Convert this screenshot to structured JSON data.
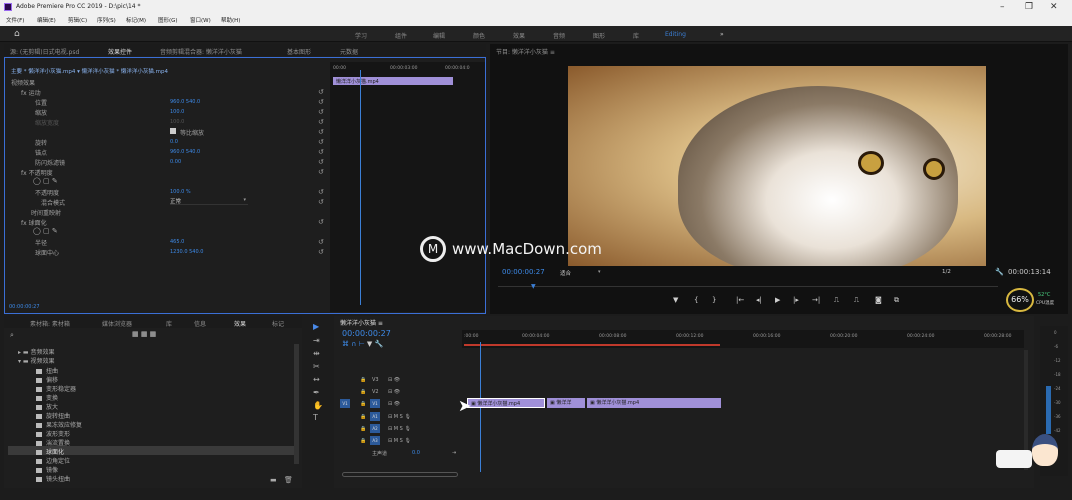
{
  "window": {
    "title": "Adobe Premiere Pro CC 2019 - D:\\pic\\14 *"
  },
  "menu": [
    "文件(F)",
    "编辑(E)",
    "剪辑(C)",
    "序列(S)",
    "标记(M)",
    "图形(G)",
    "窗口(W)",
    "帮助(H)"
  ],
  "workspaces": [
    "学习",
    "组件",
    "编辑",
    "颜色",
    "效果",
    "音频",
    "图形",
    "库",
    "Editing",
    "»"
  ],
  "top_left_tabs": [
    "源: (无剪辑)日式电视.psd",
    "效果控件",
    "音频剪辑混合器: 懒洋洋小灰猫",
    "基本图形",
    "元数据"
  ],
  "effect_controls": {
    "breadcrumb": "主要 * 懒洋洋小灰猫.mp4 ▾  懒洋洋小灰猫 * 懒洋洋小灰猫.mp4",
    "section": "视频效果",
    "rows": [
      {
        "label": "fx  运动",
        "value": ""
      },
      {
        "label": "位置",
        "value": "960.0     540.0"
      },
      {
        "label": "缩放",
        "value": "100.0"
      },
      {
        "label": "缩放宽度",
        "value": "100.0"
      },
      {
        "label": "",
        "value": "等比缩放"
      },
      {
        "label": "旋转",
        "value": "0.0"
      },
      {
        "label": "锚点",
        "value": "960.0     540.0"
      },
      {
        "label": "防闪烁滤镜",
        "value": "0.00"
      },
      {
        "label": "fx  不透明度",
        "value": ""
      },
      {
        "label": "不透明度",
        "value": "100.0 %"
      },
      {
        "label": "混合模式",
        "value": "正常"
      },
      {
        "label": "时间重映射",
        "value": ""
      },
      {
        "label": "fx  球面化",
        "value": ""
      },
      {
        "label": "半径",
        "value": "465.0"
      },
      {
        "label": "球面中心",
        "value": "1230.0     540.0"
      }
    ],
    "timecode": "00:00:00:27",
    "mini_ruler": [
      "00:00",
      "00:00:03:00",
      "00:00:04:0"
    ],
    "mini_clip": "懒洋洋小灰猫.mp4"
  },
  "program": {
    "tab": "节目: 懒洋洋小灰猫  ≡",
    "timecode": "00:00:00:27",
    "fit": "适合",
    "ratio": "1/2",
    "duration": "00:00:13:14",
    "watermark": "www.MacDown.com",
    "cpu_pct": "66%",
    "cpu_temp": "52°C",
    "cpu_label": "CPU温度"
  },
  "project": {
    "tabs": [
      "素材箱: 素材箱",
      "媒体浏览器",
      "库",
      "信息",
      "效果",
      "标记"
    ],
    "items": [
      "视频过渡",
      "扭曲",
      "偏移",
      "变形稳定器",
      "变换",
      "放大",
      "旋转扭曲",
      "果冻效应修复",
      "波形变形",
      "湍流置换",
      "球面化",
      "边角定位",
      "镜像",
      "镜头扭曲"
    ],
    "folders": [
      "音频效果",
      "视频效果"
    ]
  },
  "timeline": {
    "tab": "懒洋洋小灰猫  ≡",
    "timecode": "00:00:00:27",
    "ruler": [
      ":00:00",
      "00:00:04:00",
      "00:00:08:00",
      "00:00:12:00",
      "00:00:16:00",
      "00:00:20:00",
      "00:00:24:00",
      "00:00:28:00"
    ],
    "tracks": [
      "V3",
      "V2",
      "V1",
      "A1",
      "A2",
      "A3",
      "主声道"
    ],
    "master_val": "0.0",
    "clips": [
      "懒洋洋小灰猫.mp4",
      "懒洋洋",
      "懒洋洋小灰猫.mp4"
    ]
  },
  "audio_meter": [
    "0",
    "-6",
    "-12",
    "-18",
    "-24",
    "-30",
    "-36",
    "-42",
    "-48",
    "-54"
  ]
}
